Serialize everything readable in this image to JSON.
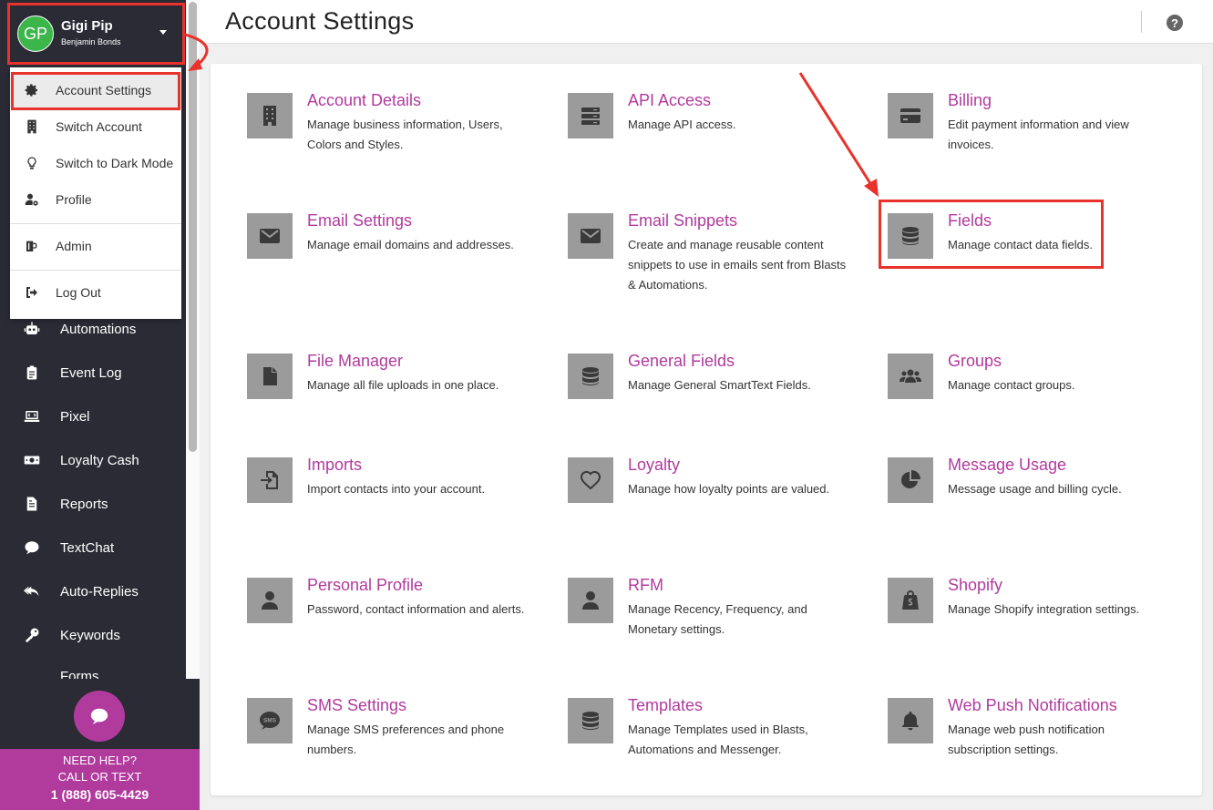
{
  "account": {
    "initials": "GP",
    "name": "Gigi Pip",
    "subaccount": "Benjamin Bonds"
  },
  "dropdown": [
    {
      "label": "Account Settings",
      "icon": "gear-icon"
    },
    {
      "label": "Switch Account",
      "icon": "building-icon"
    },
    {
      "label": "Switch to Dark Mode",
      "icon": "lightbulb-icon"
    },
    {
      "label": "Profile",
      "icon": "user-cog-icon"
    },
    {
      "label": "Admin",
      "icon": "admin-icon"
    },
    {
      "label": "Log Out",
      "icon": "logout-icon"
    }
  ],
  "nav": [
    {
      "label": "Automations",
      "icon": "robot-icon"
    },
    {
      "label": "Event Log",
      "icon": "clipboard-icon"
    },
    {
      "label": "Pixel",
      "icon": "laptop-code-icon"
    },
    {
      "label": "Loyalty Cash",
      "icon": "money-icon"
    },
    {
      "label": "Reports",
      "icon": "file-icon"
    },
    {
      "label": "TextChat",
      "icon": "comment-icon"
    },
    {
      "label": "Auto-Replies",
      "icon": "reply-all-icon"
    },
    {
      "label": "Keywords",
      "icon": "key-icon"
    },
    {
      "label": "Forms",
      "icon": "form-icon"
    }
  ],
  "help": {
    "line1": "NEED HELP?",
    "line2": "CALL OR TEXT",
    "phone": "1 (888) 605-4429"
  },
  "header": {
    "title": "Account Settings",
    "help_glyph": "?"
  },
  "cards": [
    {
      "title": "Account Details",
      "desc": "Manage business information, Users, Colors and Styles.",
      "icon": "building-icon"
    },
    {
      "title": "API Access",
      "desc": "Manage API access.",
      "icon": "server-icon"
    },
    {
      "title": "Billing",
      "desc": "Edit payment information and view invoices.",
      "icon": "credit-card-icon"
    },
    {
      "title": "Email Settings",
      "desc": "Manage email domains and addresses.",
      "icon": "envelope-icon"
    },
    {
      "title": "Email Snippets",
      "desc": "Create and manage reusable content snippets to use in emails sent from Blasts & Automations.",
      "icon": "envelope-icon"
    },
    {
      "title": "Fields",
      "desc": "Manage contact data fields.",
      "icon": "database-icon"
    },
    {
      "title": "File Manager",
      "desc": "Manage all file uploads in one place.",
      "icon": "file-icon"
    },
    {
      "title": "General Fields",
      "desc": "Manage General SmartText Fields.",
      "icon": "database-icon"
    },
    {
      "title": "Groups",
      "desc": "Manage contact groups.",
      "icon": "users-icon"
    },
    {
      "title": "Imports",
      "desc": "Import contacts into your account.",
      "icon": "file-import-icon"
    },
    {
      "title": "Loyalty",
      "desc": "Manage how loyalty points are valued.",
      "icon": "heart-icon"
    },
    {
      "title": "Message Usage",
      "desc": "Message usage and billing cycle.",
      "icon": "pie-chart-icon"
    },
    {
      "title": "Personal Profile",
      "desc": "Password, contact information and alerts.",
      "icon": "user-icon"
    },
    {
      "title": "RFM",
      "desc": "Manage Recency, Frequency, and Monetary settings.",
      "icon": "user-icon"
    },
    {
      "title": "Shopify",
      "desc": "Manage Shopify integration settings.",
      "icon": "shopify-icon"
    },
    {
      "title": "SMS Settings",
      "desc": "Manage SMS preferences and phone numbers.",
      "icon": "sms-icon"
    },
    {
      "title": "Templates",
      "desc": "Manage Templates used in Blasts, Automations and Messenger.",
      "icon": "database-icon"
    },
    {
      "title": "Web Push Notifications",
      "desc": "Manage web push notification subscription settings.",
      "icon": "bell-icon"
    }
  ],
  "colors": {
    "accent": "#b13a9d",
    "sidebar": "#2b2b36",
    "annotation": "#e8322b",
    "avatar": "#3cb54a"
  }
}
